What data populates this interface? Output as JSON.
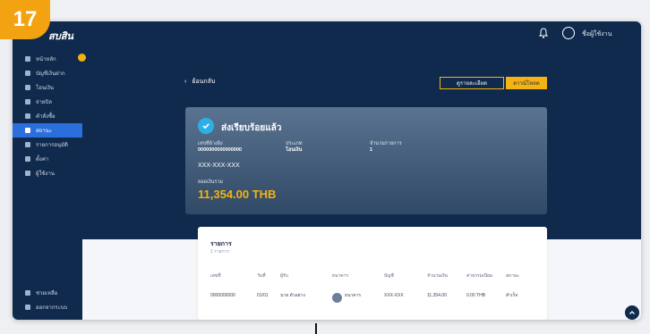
{
  "step": "17",
  "app": {
    "brand": "สบสิน",
    "user": "ชื่อผู้ใช้งาน"
  },
  "sidebar": {
    "items": [
      {
        "label": "หน้าหลัก",
        "active": false
      },
      {
        "label": "บัญชีเงินฝาก",
        "active": false
      },
      {
        "label": "โอนเงิน",
        "active": false
      },
      {
        "label": "จ่ายบิล",
        "active": false
      },
      {
        "label": "คำสั่งซื้อ",
        "active": false
      },
      {
        "label": "สถานะ",
        "active": true
      },
      {
        "label": "รายการอนุมัติ",
        "active": false
      },
      {
        "label": "ตั้งค่า",
        "active": false
      },
      {
        "label": "ผู้ใช้งาน",
        "active": false
      }
    ],
    "bottom": [
      {
        "label": "ช่วยเหลือ"
      },
      {
        "label": "ออกจากระบบ"
      }
    ]
  },
  "header": {
    "back_label": "ย้อนกลับ",
    "outline_btn": "ดูรายละเอียด",
    "primary_btn": "ดาวน์โหลด"
  },
  "status": {
    "title": "ส่งเรียบร้อยแล้ว",
    "f1_label": "เลขที่อ้างอิง",
    "f1_value": "0000000000000000",
    "f2_label": "ประเภท",
    "f2_value": "โอนเงิน",
    "f3_label": "จำนวนรายการ",
    "f3_value": "1",
    "account": "XXX-XXX-XXX",
    "amount_label": "ยอดเงินรวม",
    "amount": "11,354.00 THB"
  },
  "table": {
    "title": "รายการ",
    "subtitle": "1 รายการ",
    "headers": [
      "เลขที่",
      "วันที่",
      "ผู้รับ",
      "ธนาคาร",
      "บัญชี",
      "จำนวนเงิน",
      "ค่าธรรมเนียม",
      "สถานะ"
    ],
    "rows": [
      [
        "0000000000",
        "01/01",
        "นาย ตัวอย่าง",
        "ธนาคาร",
        "XXX-XXX",
        "11,354.00",
        "0.00 THB",
        "สำเร็จ"
      ]
    ]
  },
  "colors": {
    "navy": "#0f2a4c",
    "accent": "#f3b312",
    "active": "#2a6fdb"
  }
}
